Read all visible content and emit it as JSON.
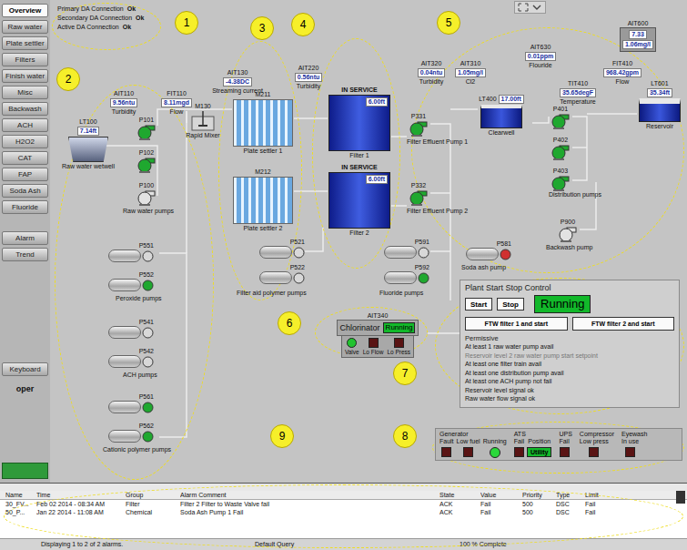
{
  "sidebar": {
    "items": [
      {
        "label": "Overview",
        "selected": true
      },
      {
        "label": "Raw water",
        "selected": false
      },
      {
        "label": "Plate settler",
        "selected": false
      },
      {
        "label": "Filters",
        "selected": false
      },
      {
        "label": "Finish water",
        "selected": false
      },
      {
        "label": "Misc",
        "selected": false
      },
      {
        "label": "Backwash",
        "selected": false
      },
      {
        "label": "ACH",
        "selected": false
      },
      {
        "label": "H2O2",
        "selected": false
      },
      {
        "label": "CAT",
        "selected": false
      },
      {
        "label": "FAP",
        "selected": false
      },
      {
        "label": "Soda Ash",
        "selected": false
      },
      {
        "label": "Fluoride",
        "selected": false
      }
    ],
    "tools": [
      {
        "label": "Alarm"
      },
      {
        "label": "Trend"
      }
    ],
    "keyboard": "Keyboard",
    "user": "oper"
  },
  "connections": [
    {
      "label": "Primary DA Connection",
      "value": "Ok"
    },
    {
      "label": "Secondary DA Connection",
      "value": "Ok"
    },
    {
      "label": "Active DA Connection",
      "value": "Ok"
    }
  ],
  "instruments": [
    {
      "tag": "AIT110",
      "value": "9.56ntu",
      "caption": "Turbidity"
    },
    {
      "tag": "FIT110",
      "value": "8.11mgd",
      "caption": "Flow"
    },
    {
      "tag": "AIT130",
      "value": "-4.38DC",
      "caption": "Streaming current"
    },
    {
      "tag": "AIT220",
      "value": "0.56ntu",
      "caption": "Turbidity"
    },
    {
      "tag": "AIT320",
      "value": "0.04ntu",
      "caption": "Turbidity"
    },
    {
      "tag": "AIT310",
      "value": "1.05mg/l",
      "caption": "Cl2"
    },
    {
      "tag": "AIT630",
      "value": "0.01ppm",
      "caption": "Flouride"
    },
    {
      "tag": "TIT410",
      "value": "35.65degF",
      "caption": "Temperature"
    },
    {
      "tag": "FIT410",
      "value": "968.42gpm",
      "caption": "Flow"
    }
  ],
  "analyzer": {
    "tag": "AIT600",
    "values": [
      "7.33",
      "1.06mg/l"
    ]
  },
  "tanks": [
    {
      "kind": "wetwell",
      "tag": "LT100",
      "value": "7.14ft",
      "caption": "Raw water wetwell"
    },
    {
      "kind": "filter",
      "status": "IN SERVICE",
      "value": "6.00ft",
      "caption": "Filter 1"
    },
    {
      "kind": "filter",
      "status": "IN SERVICE",
      "value": "6.00ft",
      "caption": "Filter 2"
    },
    {
      "kind": "clearwell",
      "tag": "LT400",
      "value": "17.00ft",
      "caption": "Clearwell"
    },
    {
      "kind": "reservoir",
      "tag": "LT601",
      "value": "35.34ft",
      "caption": "Reservoir"
    }
  ],
  "equipment": [
    {
      "kind": "mixer",
      "tag": "M130",
      "caption": "Rapid Mixer"
    },
    {
      "kind": "settler",
      "tag": "M211",
      "caption": "Plate settler 1"
    },
    {
      "kind": "settler",
      "tag": "M212",
      "caption": "Plate settler 2"
    }
  ],
  "pumps": [
    {
      "tag": "P101",
      "kind": "centrifugal",
      "color": "#1fa82f"
    },
    {
      "tag": "P102",
      "kind": "centrifugal",
      "color": "#1fa82f"
    },
    {
      "tag": "P100",
      "kind": "centrifugal",
      "color": "#e2e2e2"
    },
    {
      "tag": "P331",
      "kind": "centrifugal",
      "color": "#1fa82f"
    },
    {
      "tag": "P332",
      "kind": "centrifugal",
      "color": "#1fa82f"
    },
    {
      "tag": "P401",
      "kind": "centrifugal",
      "color": "#1fa82f"
    },
    {
      "tag": "P402",
      "kind": "centrifugal",
      "color": "#1fa82f"
    },
    {
      "tag": "P403",
      "kind": "centrifugal",
      "color": "#1fa82f"
    },
    {
      "tag": "P900",
      "kind": "centrifugal",
      "color": "#e2e2e2"
    },
    {
      "tag": "P581",
      "kind": "metering",
      "color": "#d03030"
    },
    {
      "tag": "P591",
      "kind": "metering",
      "color": "#d8d8d8"
    },
    {
      "tag": "P592",
      "kind": "metering",
      "color": "#1fa82f"
    },
    {
      "tag": "P521",
      "kind": "metering",
      "color": "#d8d8d8"
    },
    {
      "tag": "P522",
      "kind": "metering",
      "color": "#d8d8d8"
    },
    {
      "tag": "P551",
      "kind": "metering",
      "color": "#d8d8d8"
    },
    {
      "tag": "P552",
      "kind": "metering",
      "color": "#1fa82f"
    },
    {
      "tag": "P541",
      "kind": "metering",
      "color": "#d8d8d8"
    },
    {
      "tag": "P542",
      "kind": "metering",
      "color": "#d8d8d8"
    },
    {
      "tag": "P561",
      "kind": "metering",
      "color": "#1fa82f"
    },
    {
      "tag": "P562",
      "kind": "metering",
      "color": "#1fa82f"
    }
  ],
  "pump_labels": [
    "Raw water pumps",
    "Filter Effluent Pump 1",
    "Filter Effluent Pump 2",
    "Distribution pumps",
    "Backwash pump",
    "Soda ash pump",
    "Fluoride pumps",
    "Filter aid polymer pumps",
    "Peroxide pumps",
    "ACH pumps",
    "Cationic polymer pumps"
  ],
  "chlorinator": {
    "tag": "AIT340",
    "title": "Chlorinator",
    "status": "Running",
    "indicators": [
      {
        "label": "Valve",
        "on": true
      },
      {
        "label": "Lo Flow",
        "on": false
      },
      {
        "label": "Lo Press",
        "on": false
      }
    ]
  },
  "plant_control": {
    "title": "Plant Start Stop Control",
    "buttons": [
      "Start",
      "Stop"
    ],
    "status": "Running",
    "ftw_buttons": [
      "FTW filter 1 and start",
      "FTW filter 2 and start"
    ],
    "permissive_title": "Permissive",
    "permissives": [
      {
        "label": "At least 1 raw water pump avail",
        "ok": true
      },
      {
        "label": "Reservoir level 2 raw water pump start setpoint",
        "ok": false
      },
      {
        "label": "At least one filter train avail",
        "ok": true
      },
      {
        "label": "At least one distribution pump avail",
        "ok": true
      },
      {
        "label": "At least one ACH pump not fail",
        "ok": true
      },
      {
        "label": "Reservoir level signal ok",
        "ok": true
      },
      {
        "label": "Raw water flow signal ok",
        "ok": true
      }
    ]
  },
  "status_strip": [
    {
      "title": "Generator",
      "items": [
        {
          "kind": "box",
          "label": "Fault",
          "on": false
        },
        {
          "kind": "box",
          "label": "Low fuel",
          "on": false
        },
        {
          "kind": "lamp",
          "label": "Running",
          "on": true
        }
      ]
    },
    {
      "title": "ATS",
      "items": [
        {
          "kind": "box",
          "label": "Fail",
          "on": false
        },
        {
          "kind": "value",
          "label": "Position",
          "value": "Utility"
        }
      ]
    },
    {
      "title": "UPS",
      "items": [
        {
          "kind": "box",
          "label": "Fail",
          "on": false
        }
      ]
    },
    {
      "title": "Compressor",
      "items": [
        {
          "kind": "box",
          "label": "Low press",
          "on": false
        }
      ]
    },
    {
      "title": "Eyewash",
      "items": [
        {
          "kind": "box",
          "label": "In use",
          "on": false
        }
      ]
    }
  ],
  "annotations": [
    {
      "label": "1"
    },
    {
      "label": "2"
    },
    {
      "label": "3"
    },
    {
      "label": "4"
    },
    {
      "label": "5"
    },
    {
      "label": "6"
    },
    {
      "label": "7"
    },
    {
      "label": "8"
    },
    {
      "label": "9"
    }
  ],
  "alarms": {
    "columns": [
      "Name",
      "Time",
      "Group",
      "Alarm Comment",
      "State",
      "Value",
      "Priority",
      "Type",
      "Limit"
    ],
    "rows": [
      [
        "30_FV...",
        "Feb 02 2014 - 08:34 AM",
        "Filter",
        "Filter 2 Filter to Waste Valve fail",
        "ACK",
        "Fail",
        "500",
        "DSC",
        "Fail"
      ],
      [
        "50_P...",
        "Jan 22 2014 - 11:08 AM",
        "Chemical",
        "Soda Ash Pump 1 Fail",
        "ACK",
        "Fail",
        "500",
        "DSC",
        "Fail"
      ]
    ],
    "status_bar": [
      "Displaying 1 to 2 of 2 alarms.",
      "Default Query",
      "100 % Complete"
    ]
  }
}
